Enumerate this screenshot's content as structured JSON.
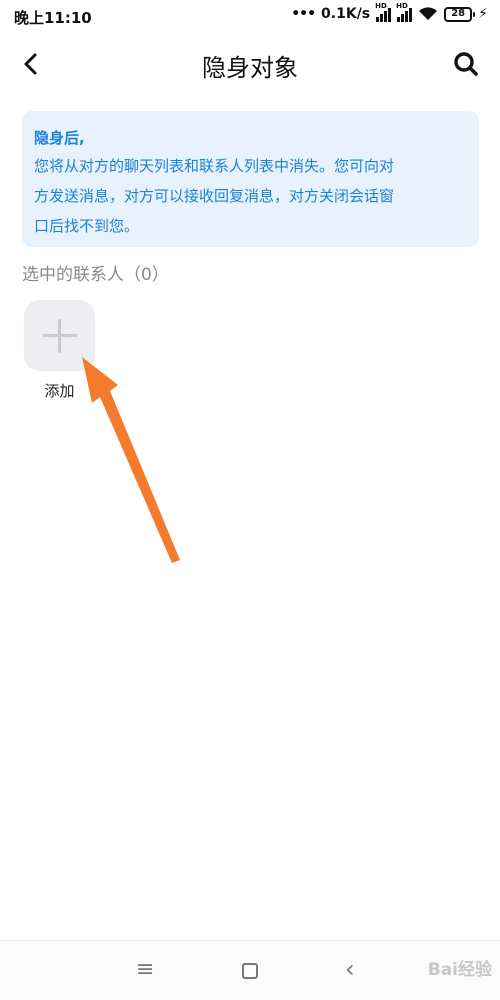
{
  "status_bar": {
    "time": "晚上11:10",
    "network_speed": "0.1K/s",
    "signal_badge_1": "HD",
    "signal_badge_2": "HD",
    "battery_level": "28"
  },
  "header": {
    "title": "隐身对象",
    "back_icon": "chevron-left-icon",
    "search_icon": "search-icon"
  },
  "info_card": {
    "title": "隐身后,",
    "line1": "您将从对方的聊天列表和联系人列表中消失。您可向对",
    "line2": "方发送消息，对方可以接收回复消息，对方关闭会话窗",
    "line3": "口后找不到您。"
  },
  "section": {
    "label": "选中的联系人（0）"
  },
  "add_tile": {
    "label": "添加"
  },
  "nav_bar": {
    "menu_icon": "≡",
    "back_icon": "‹"
  },
  "watermark": {
    "text": "Bai经验"
  },
  "colors": {
    "accent": "#1a82d6",
    "card_bg": "#e8f2fc",
    "arrow": "#f47a2c"
  }
}
